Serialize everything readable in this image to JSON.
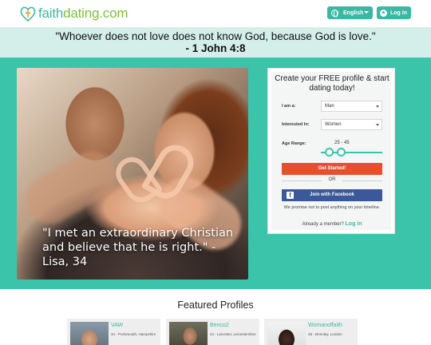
{
  "header": {
    "logo_text_main": "faith",
    "logo_text_suffix": "dating.com",
    "language_label": "English",
    "login_label": "Log in"
  },
  "quote": {
    "text": "\"Whoever does not love does not know God, because God is love.\"",
    "reference": "- 1 John 4:8"
  },
  "hero": {
    "testimonial": "\"I met an extraordinary Christian and believe that he is right.\" - Lisa, 34"
  },
  "signup": {
    "title": "Create your FREE profile & start dating today!",
    "iam_label": "I am a:",
    "iam_value": "Man",
    "interested_label": "Interested In:",
    "interested_value": "Women",
    "age_label": "Age Range:",
    "age_value": "25 - 45",
    "start_label": "Get Started!",
    "or_label": "OR",
    "facebook_label": "Join with Facebook",
    "promise_text": "We promise not to post anything on your timeline.",
    "member_text": "Already a member?",
    "login_link": "Log in"
  },
  "featured": {
    "title": "Featured Profiles",
    "profiles": [
      {
        "name": "VAW",
        "location": "34 - Portsmouth, Hampshire"
      },
      {
        "name": "Benco2",
        "location": "44 - Leicester, Leicestershire"
      },
      {
        "name": "Womanoffaith",
        "location": "38 - Bromley, London"
      }
    ]
  },
  "colors": {
    "brand_teal": "#3bb8a4",
    "hero_bg": "#3cc4ab",
    "quote_bg": "#d4efe9",
    "start_button": "#ea4f2b",
    "facebook_button": "#3b5998"
  }
}
